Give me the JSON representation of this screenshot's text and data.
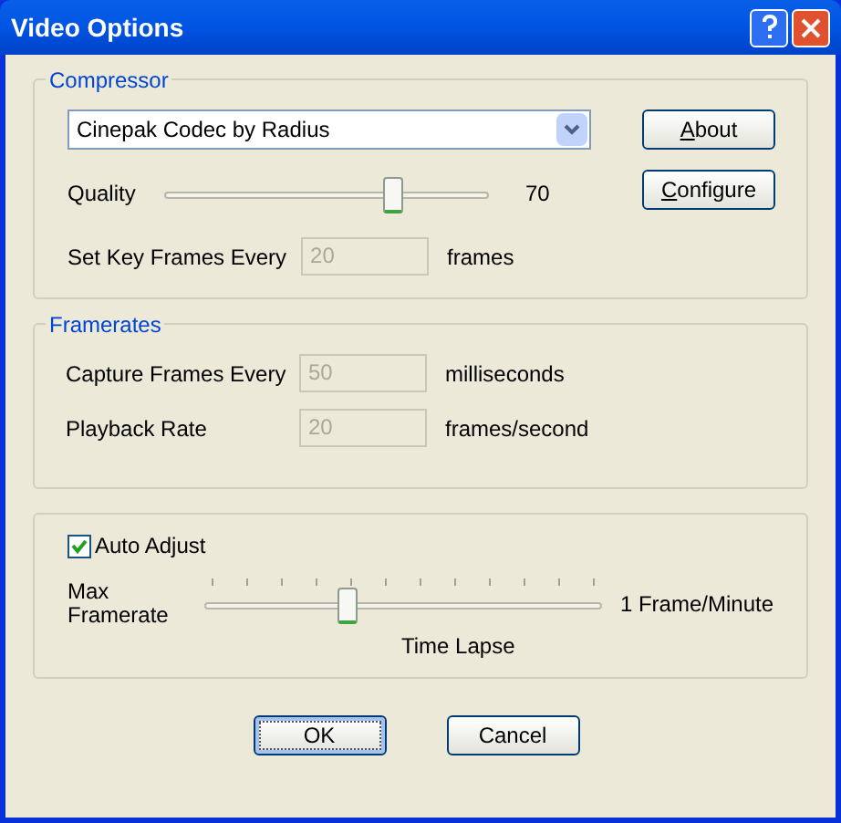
{
  "window": {
    "title": "Video Options"
  },
  "compressor": {
    "title": "Compressor",
    "codec": "Cinepak Codec by Radius",
    "about_button": {
      "label": "About",
      "first_letter_underlined": true
    },
    "configure_button": {
      "label": "Configure",
      "first_letter_underlined": true
    },
    "quality": {
      "label": "Quality",
      "level": 0.7,
      "reading": "70"
    },
    "key_frames": {
      "label": "Set Key Frames Every",
      "value": "20",
      "unit": "frames",
      "disabled": true
    }
  },
  "framerates": {
    "title": "Framerates",
    "fields": [
      {
        "label": "Capture Frames Every",
        "value": "50",
        "unit": "milliseconds",
        "disabled": true
      },
      {
        "label": "Playback Rate",
        "value": "20",
        "unit": "frames/second",
        "disabled": true
      }
    ]
  },
  "auto_adjust": {
    "label": "Auto Adjust",
    "checked": true,
    "slider_label": "Max Framerate",
    "level": 0.36,
    "end_label": "1 Frame/Minute",
    "caption": "Time Lapse"
  },
  "buttons": [
    {
      "label": "OK",
      "default": true
    },
    {
      "label": "Cancel",
      "default": false
    }
  ]
}
